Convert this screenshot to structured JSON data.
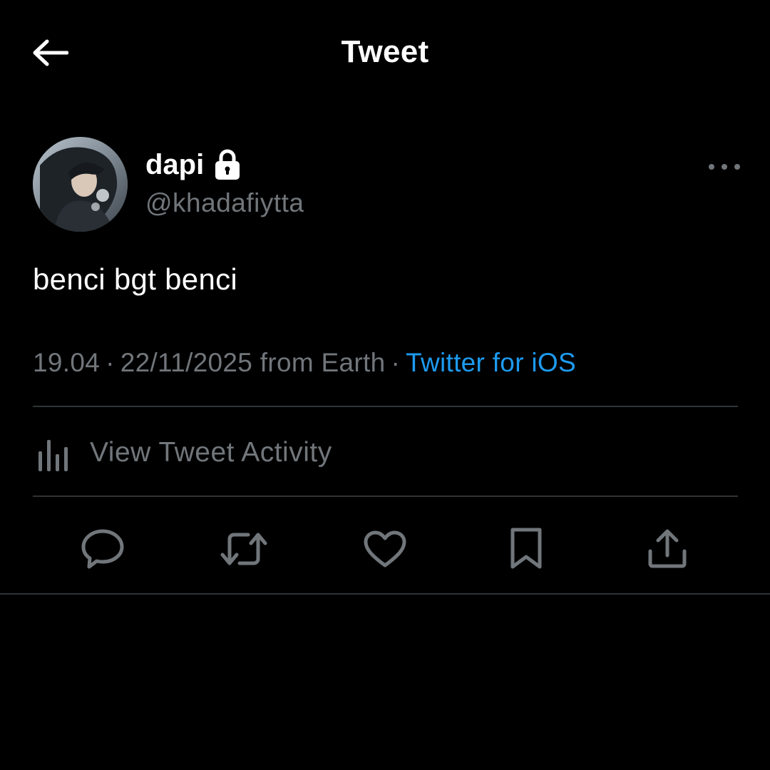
{
  "header": {
    "title": "Tweet",
    "back_icon": "arrow-left-icon"
  },
  "tweet": {
    "author": {
      "display_name": "dapi",
      "handle": "@khadafiytta",
      "protected_icon": "lock-icon",
      "avatar": "profile-photo"
    },
    "text": "benci bgt benci",
    "time": "19.04",
    "date": "22/11/2025",
    "location": "from Earth",
    "separator": "·",
    "source": "Twitter for iOS",
    "more_icon": "more-horizontal-icon"
  },
  "activity": {
    "label": "View Tweet Activity",
    "icon": "bar-chart-icon"
  },
  "actions": [
    {
      "name": "reply",
      "icon": "reply-icon"
    },
    {
      "name": "retweet",
      "icon": "retweet-icon"
    },
    {
      "name": "like",
      "icon": "heart-icon"
    },
    {
      "name": "bookmark",
      "icon": "bookmark-icon"
    },
    {
      "name": "share",
      "icon": "share-icon"
    }
  ],
  "colors": {
    "background": "#000000",
    "primary_text": "#ffffff",
    "secondary_text": "#71767b",
    "accent": "#1d9bf0",
    "divider": "#2f3336"
  }
}
